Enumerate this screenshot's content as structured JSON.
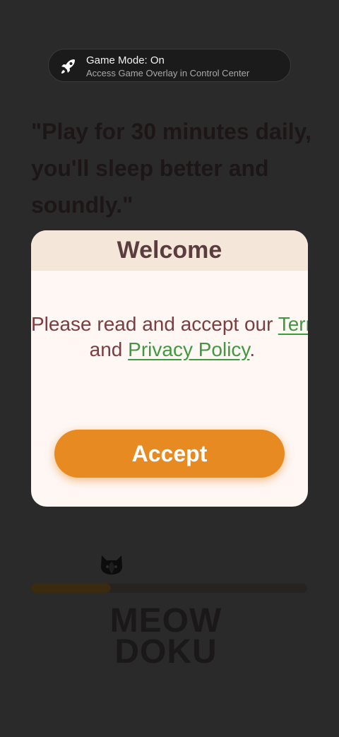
{
  "banner": {
    "title": "Game Mode: On",
    "subtitle": "Access Game Overlay in Control Center",
    "icon": "rocket-icon"
  },
  "quote": {
    "text": "\"Play for 30 minutes daily, you'll sleep better and soundly.\""
  },
  "modal": {
    "title": "Welcome",
    "body_prefix": "Please read and accept our ",
    "terms_link": "Terms of Service",
    "body_middle": " and ",
    "privacy_link": "Privacy Policy",
    "body_suffix": ".",
    "accept_label": "Accept"
  },
  "progress": {
    "value": 0.29,
    "icon": "cat-icon"
  },
  "logo": {
    "line1": "MEOW",
    "line2": "DOKU"
  },
  "colors": {
    "accent": "#e88a22",
    "link": "#3f9a3f",
    "modal_text": "#7d3c3f",
    "title": "#5a3d3e"
  }
}
